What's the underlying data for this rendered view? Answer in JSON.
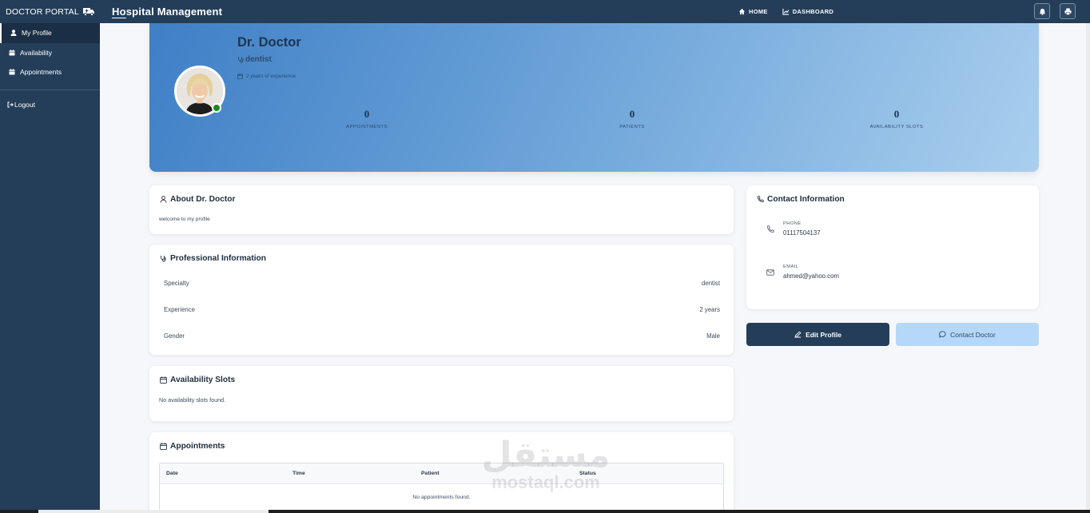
{
  "topbar": {
    "brand": "DOCTOR PORTAL",
    "title_first": "Ho",
    "title_rest": "spital Management",
    "nav": [
      {
        "label": "HOME",
        "icon": "home-icon"
      },
      {
        "label": "DASHBOARD",
        "icon": "chart-icon"
      }
    ]
  },
  "sidebar": {
    "items": [
      {
        "label": "My Profile",
        "icon": "user-icon",
        "active": true
      },
      {
        "label": "Availability",
        "icon": "calendar-icon"
      },
      {
        "label": "Appointments",
        "icon": "calendar-icon"
      }
    ],
    "logout": "Logout"
  },
  "profile": {
    "name": "Dr. Doctor",
    "specialty": "dentist",
    "experience": "2 years of experience",
    "stats": [
      {
        "value": "0",
        "label": "APPOINTMENTS"
      },
      {
        "value": "0",
        "label": "PATIENTS"
      },
      {
        "value": "0",
        "label": "AVAILABILITY SLOTS"
      }
    ]
  },
  "about": {
    "title": "About Dr. Doctor",
    "text": "welcome to my profile"
  },
  "professional": {
    "title": "Professional Information",
    "rows": [
      {
        "label": "Specialty",
        "value": "dentist"
      },
      {
        "label": "Experience",
        "value": "2 years"
      },
      {
        "label": "Gender",
        "value": "Male"
      }
    ]
  },
  "availability": {
    "title": "Availability Slots",
    "empty": "No availability slots found."
  },
  "appointments": {
    "title": "Appointments",
    "columns": [
      "Date",
      "Time",
      "Patient",
      "Status"
    ],
    "empty": "No appointments found."
  },
  "contact": {
    "title": "Contact Information",
    "phone_label": "PHONE",
    "phone": "01117504137",
    "email_label": "EMAIL",
    "email": "ahmed@yahoo.com"
  },
  "actions": {
    "edit": "Edit Profile",
    "contact": "Contact Doctor"
  },
  "watermark": {
    "arabic": "مستقل",
    "latin": "mostaql.com"
  },
  "colors": {
    "navy": "#243e5a",
    "online": "#1b8a1b",
    "contact_button": "#b6d8f8"
  }
}
